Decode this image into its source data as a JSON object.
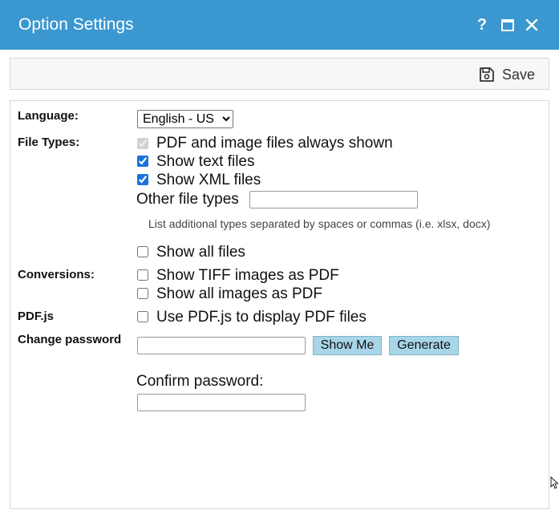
{
  "window": {
    "title": "Option Settings"
  },
  "toolbar": {
    "save_label": "Save"
  },
  "settings": {
    "language": {
      "label": "Language:",
      "selected": "English - US"
    },
    "file_types": {
      "label": "File Types:",
      "pdf_images": {
        "label": "PDF and image files always shown",
        "checked": true,
        "disabled": true
      },
      "text_files": {
        "label": "Show text files",
        "checked": true
      },
      "xml_files": {
        "label": "Show XML files",
        "checked": true
      },
      "other_types": {
        "label": "Other file types",
        "value": ""
      },
      "hint": "List additional types separated by spaces or commas (i.e. xlsx, docx)",
      "all_files": {
        "label": "Show all files",
        "checked": false
      }
    },
    "conversions": {
      "label": "Conversions:",
      "tiff_pdf": {
        "label": "Show TIFF images as PDF",
        "checked": false
      },
      "images_pdf": {
        "label": "Show all images as PDF",
        "checked": false
      }
    },
    "pdfjs": {
      "label": "PDF.js",
      "use_pdfjs": {
        "label": "Use PDF.js to display PDF files",
        "checked": false
      }
    },
    "password": {
      "label": "Change password",
      "value": "",
      "show_me_label": "Show Me",
      "generate_label": "Generate",
      "confirm_label": "Confirm password:",
      "confirm_value": ""
    }
  },
  "colors": {
    "titlebar": "#3a97d0",
    "button": "#a8d5e8"
  }
}
